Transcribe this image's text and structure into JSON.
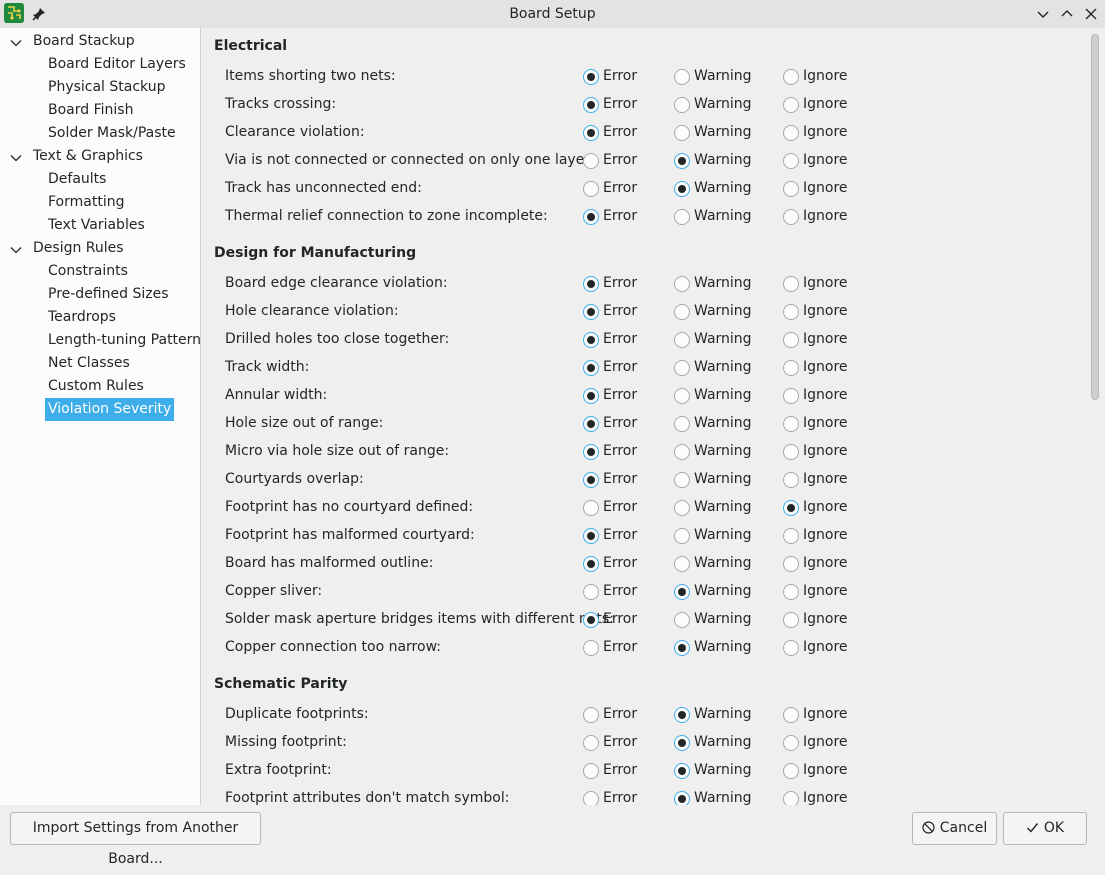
{
  "window": {
    "title": "Board Setup"
  },
  "sidebar": {
    "groups": [
      {
        "label": "Board Stackup",
        "children": [
          "Board Editor Layers",
          "Physical Stackup",
          "Board Finish",
          "Solder Mask/Paste"
        ]
      },
      {
        "label": "Text & Graphics",
        "children": [
          "Defaults",
          "Formatting",
          "Text Variables"
        ]
      },
      {
        "label": "Design Rules",
        "children": [
          "Constraints",
          "Pre-defined Sizes",
          "Teardrops",
          "Length-tuning Patterns",
          "Net Classes",
          "Custom Rules",
          "Violation Severity"
        ]
      }
    ],
    "selected": "Violation Severity"
  },
  "severity_labels": {
    "error": "Error",
    "warning": "Warning",
    "ignore": "Ignore"
  },
  "sections": [
    {
      "title": "Electrical",
      "rows": [
        {
          "label": "Items shorting two nets:",
          "value": "error"
        },
        {
          "label": "Tracks crossing:",
          "value": "error"
        },
        {
          "label": "Clearance violation:",
          "value": "error"
        },
        {
          "label": "Via is not connected or connected on only one layer:",
          "value": "warning"
        },
        {
          "label": "Track has unconnected end:",
          "value": "warning"
        },
        {
          "label": "Thermal relief connection to zone incomplete:",
          "value": "error"
        }
      ]
    },
    {
      "title": "Design for Manufacturing",
      "rows": [
        {
          "label": "Board edge clearance violation:",
          "value": "error"
        },
        {
          "label": "Hole clearance violation:",
          "value": "error"
        },
        {
          "label": "Drilled holes too close together:",
          "value": "error"
        },
        {
          "label": "Track width:",
          "value": "error"
        },
        {
          "label": "Annular width:",
          "value": "error"
        },
        {
          "label": "Hole size out of range:",
          "value": "error"
        },
        {
          "label": "Micro via hole size out of range:",
          "value": "error"
        },
        {
          "label": "Courtyards overlap:",
          "value": "error"
        },
        {
          "label": "Footprint has no courtyard defined:",
          "value": "ignore"
        },
        {
          "label": "Footprint has malformed courtyard:",
          "value": "error"
        },
        {
          "label": "Board has malformed outline:",
          "value": "error"
        },
        {
          "label": "Copper sliver:",
          "value": "warning"
        },
        {
          "label": "Solder mask aperture bridges items with different nets:",
          "value": "error"
        },
        {
          "label": "Copper connection too narrow:",
          "value": "warning"
        }
      ]
    },
    {
      "title": "Schematic Parity",
      "rows": [
        {
          "label": "Duplicate footprints:",
          "value": "warning"
        },
        {
          "label": "Missing footprint:",
          "value": "warning"
        },
        {
          "label": "Extra footprint:",
          "value": "warning"
        },
        {
          "label": "Footprint attributes don't match symbol:",
          "value": "warning"
        }
      ]
    }
  ],
  "buttons": {
    "import": "Import Settings from Another Board...",
    "cancel": "Cancel",
    "ok": "OK"
  },
  "colors": {
    "accent": "#3daee9",
    "selected_text": "#ffffff"
  }
}
